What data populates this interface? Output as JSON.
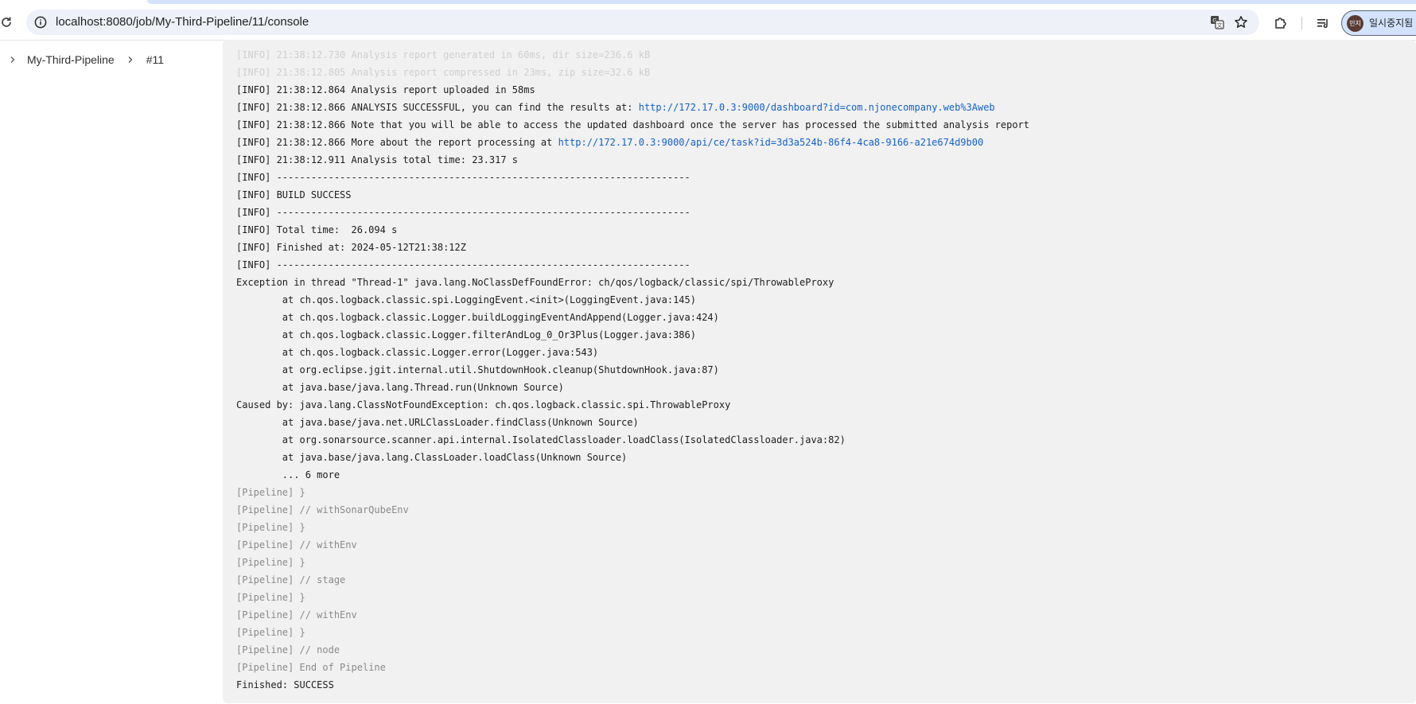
{
  "browser": {
    "url": "localhost:8080/job/My-Third-Pipeline/11/console",
    "profile_avatar_text": "민지",
    "profile_label": "일시중지됨"
  },
  "breadcrumb": [
    {
      "label": "My-Third-Pipeline"
    },
    {
      "label": "#11"
    }
  ],
  "console": {
    "lines": [
      {
        "type": "faded",
        "text": "[INFO] 21:38:12.730 Analysis report generated in 60ms, dir size=236.6 kB"
      },
      {
        "type": "faded",
        "text": "[INFO] 21:38:12.805 Analysis report compressed in 23ms, zip size=32.6 kB"
      },
      {
        "type": "normal",
        "text": "[INFO] 21:38:12.864 Analysis report uploaded in 58ms"
      },
      {
        "type": "link",
        "prefix": "[INFO] 21:38:12.866 ANALYSIS SUCCESSFUL, you can find the results at: ",
        "link": "http://172.17.0.3:9000/dashboard?id=com.njonecompany.web%3Aweb"
      },
      {
        "type": "normal",
        "text": "[INFO] 21:38:12.866 Note that you will be able to access the updated dashboard once the server has processed the submitted analysis report"
      },
      {
        "type": "link",
        "prefix": "[INFO] 21:38:12.866 More about the report processing at ",
        "link": "http://172.17.0.3:9000/api/ce/task?id=3d3a524b-86f4-4ca8-9166-a21e674d9b00"
      },
      {
        "type": "normal",
        "text": "[INFO] 21:38:12.911 Analysis total time: 23.317 s"
      },
      {
        "type": "normal",
        "text": "[INFO] ------------------------------------------------------------------------"
      },
      {
        "type": "normal",
        "text": "[INFO] BUILD SUCCESS"
      },
      {
        "type": "normal",
        "text": "[INFO] ------------------------------------------------------------------------"
      },
      {
        "type": "normal",
        "text": "[INFO] Total time:  26.094 s"
      },
      {
        "type": "normal",
        "text": "[INFO] Finished at: 2024-05-12T21:38:12Z"
      },
      {
        "type": "normal",
        "text": "[INFO] ------------------------------------------------------------------------"
      },
      {
        "type": "normal",
        "text": "Exception in thread \"Thread-1\" java.lang.NoClassDefFoundError: ch/qos/logback/classic/spi/ThrowableProxy"
      },
      {
        "type": "normal",
        "text": "\tat ch.qos.logback.classic.spi.LoggingEvent.<init>(LoggingEvent.java:145)"
      },
      {
        "type": "normal",
        "text": "\tat ch.qos.logback.classic.Logger.buildLoggingEventAndAppend(Logger.java:424)"
      },
      {
        "type": "normal",
        "text": "\tat ch.qos.logback.classic.Logger.filterAndLog_0_Or3Plus(Logger.java:386)"
      },
      {
        "type": "normal",
        "text": "\tat ch.qos.logback.classic.Logger.error(Logger.java:543)"
      },
      {
        "type": "normal",
        "text": "\tat org.eclipse.jgit.internal.util.ShutdownHook.cleanup(ShutdownHook.java:87)"
      },
      {
        "type": "normal",
        "text": "\tat java.base/java.lang.Thread.run(Unknown Source)"
      },
      {
        "type": "normal",
        "text": "Caused by: java.lang.ClassNotFoundException: ch.qos.logback.classic.spi.ThrowableProxy"
      },
      {
        "type": "normal",
        "text": "\tat java.base/java.net.URLClassLoader.findClass(Unknown Source)"
      },
      {
        "type": "normal",
        "text": "\tat org.sonarsource.scanner.api.internal.IsolatedClassloader.loadClass(IsolatedClassloader.java:82)"
      },
      {
        "type": "normal",
        "text": "\tat java.base/java.lang.ClassLoader.loadClass(Unknown Source)"
      },
      {
        "type": "normal",
        "text": "\t... 6 more"
      },
      {
        "type": "pipe",
        "text": "[Pipeline] }"
      },
      {
        "type": "pipe",
        "text": "[Pipeline] // withSonarQubeEnv"
      },
      {
        "type": "pipe",
        "text": "[Pipeline] }"
      },
      {
        "type": "pipe",
        "text": "[Pipeline] // withEnv"
      },
      {
        "type": "pipe",
        "text": "[Pipeline] }"
      },
      {
        "type": "pipe",
        "text": "[Pipeline] // stage"
      },
      {
        "type": "pipe",
        "text": "[Pipeline] }"
      },
      {
        "type": "pipe",
        "text": "[Pipeline] // withEnv"
      },
      {
        "type": "pipe",
        "text": "[Pipeline] }"
      },
      {
        "type": "pipe",
        "text": "[Pipeline] // node"
      },
      {
        "type": "pipe",
        "text": "[Pipeline] End of Pipeline"
      },
      {
        "type": "normal",
        "text": "Finished: SUCCESS"
      }
    ]
  },
  "icons": {
    "reload": "reload-icon",
    "site_info": "info-icon",
    "translate": "translate-icon",
    "bookmark": "star-icon",
    "extensions": "puzzle-icon",
    "reading_list": "reading-list-icon",
    "breadcrumb_separator": "chevron-right-icon"
  },
  "colors": {
    "link": "#1560c9",
    "console_background": "#f1f1f1",
    "pipeline_text": "#8a8a8a"
  }
}
